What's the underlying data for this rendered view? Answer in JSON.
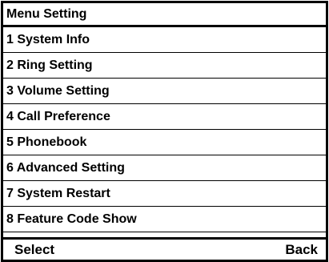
{
  "title": "Menu Setting",
  "menu": {
    "items": [
      {
        "label": "1 System Info"
      },
      {
        "label": "2 Ring Setting"
      },
      {
        "label": "3 Volume Setting"
      },
      {
        "label": "4 Call Preference"
      },
      {
        "label": "5 Phonebook"
      },
      {
        "label": "6 Advanced Setting"
      },
      {
        "label": "7 System Restart"
      },
      {
        "label": "8 Feature Code Show"
      }
    ]
  },
  "softkeys": {
    "left": "Select",
    "right": "Back"
  }
}
